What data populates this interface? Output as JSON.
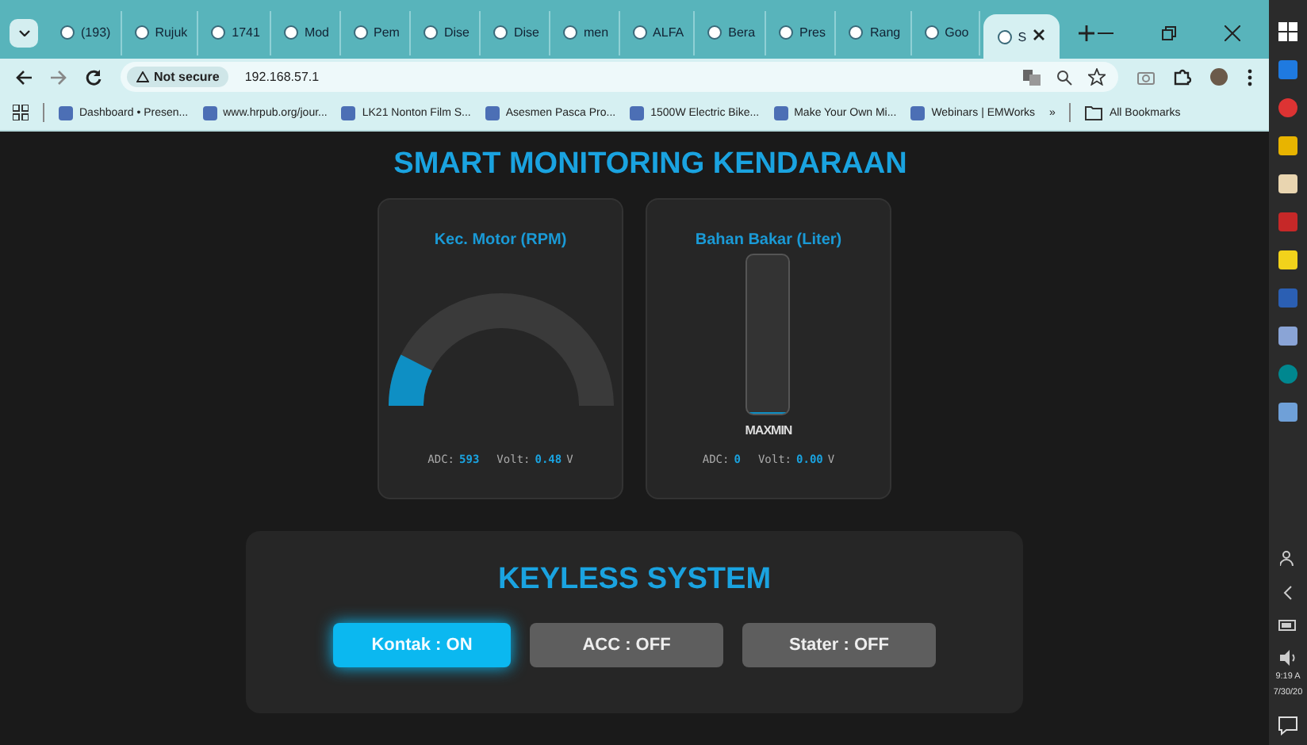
{
  "browser": {
    "tabs": [
      {
        "title": "(193)",
        "selected": false
      },
      {
        "title": "Rujuk",
        "selected": false
      },
      {
        "title": "1741",
        "selected": false
      },
      {
        "title": "Mod",
        "selected": false
      },
      {
        "title": "Pem",
        "selected": false
      },
      {
        "title": "Dise",
        "selected": false
      },
      {
        "title": "Dise",
        "selected": false
      },
      {
        "title": "men",
        "selected": false
      },
      {
        "title": "ALFA",
        "selected": false
      },
      {
        "title": "Bera",
        "selected": false
      },
      {
        "title": "Pres",
        "selected": false
      },
      {
        "title": "Rang",
        "selected": false
      },
      {
        "title": "Goo",
        "selected": false
      },
      {
        "title": "S",
        "selected": true
      }
    ],
    "address": {
      "security": "Not secure",
      "url": "192.168.57.1"
    },
    "bookmarks": [
      {
        "label": "Dashboard • Presen..."
      },
      {
        "label": "www.hrpub.org/jour..."
      },
      {
        "label": "LK21 Nonton Film S..."
      },
      {
        "label": "Asesmen Pasca Pro..."
      },
      {
        "label": "1500W Electric Bike..."
      },
      {
        "label": "Make Your Own Mi..."
      },
      {
        "label": "Webinars | EMWorks"
      }
    ],
    "bookmarks_overflow": "»",
    "all_bookmarks": "All Bookmarks"
  },
  "page": {
    "title": "SMART MONITORING KENDARAAN",
    "gauges": [
      {
        "kind": "arc",
        "title": "Kec. Motor (RPM)",
        "level": 0.15,
        "adc_label": "ADC:",
        "adc": "593",
        "volt_label": "Volt:",
        "volt": "0.48",
        "unit": "V"
      },
      {
        "kind": "tank",
        "title": "Bahan Bakar (Liter)",
        "level": 0,
        "scale": "MAXMIN",
        "adc_label": "ADC:",
        "adc": "0",
        "volt_label": "Volt:",
        "volt": "0.00",
        "unit": "V"
      }
    ],
    "keyless": {
      "title": "KEYLESS SYSTEM",
      "buttons": [
        {
          "label": "Kontak : ON",
          "on": true
        },
        {
          "label": "ACC : OFF",
          "on": false
        },
        {
          "label": "Stater : OFF",
          "on": false
        }
      ]
    }
  },
  "taskbar": {
    "time": "9:19 A",
    "date": "7/30/20"
  }
}
